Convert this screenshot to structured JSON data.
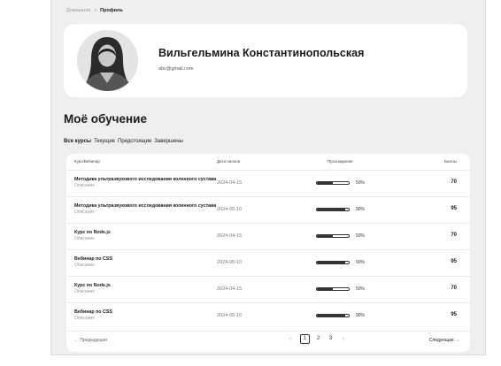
{
  "breadcrumb": {
    "home": "Домашняя",
    "separator": "»",
    "current": "Профиль"
  },
  "profile": {
    "name": "Вильгельмина Константинопольская",
    "email": "abc@gmail.com"
  },
  "section_title": "Моё обучение",
  "tabs": [
    "Все курсы",
    "Текущие",
    "Предстоящие",
    "Завершены"
  ],
  "table": {
    "headers": {
      "course": "Курс/Вебинар",
      "date": "Дата начала",
      "progress": "Прохождение",
      "score": "Баллы"
    },
    "rows": [
      {
        "title": "Методика ультразвукового исследования коленного сустава",
        "desc": "Описание",
        "date": "2024-04-15",
        "progress": 50,
        "progress_label": "50%",
        "score": "70"
      },
      {
        "title": "Методика ультразвукового исследования коленного сустава",
        "desc": "Описание",
        "date": "2024-05-10",
        "progress": 90,
        "progress_label": "90%",
        "score": "95"
      },
      {
        "title": "Курс по Node.js",
        "desc": "Описание",
        "date": "2024-04-15",
        "progress": 50,
        "progress_label": "50%",
        "score": "70"
      },
      {
        "title": "Вебинар по CSS",
        "desc": "Описание",
        "date": "2024-05-10",
        "progress": 90,
        "progress_label": "90%",
        "score": "95"
      },
      {
        "title": "Курс по Node.js",
        "desc": "Описание",
        "date": "2024-04-15",
        "progress": 50,
        "progress_label": "50%",
        "score": "70"
      },
      {
        "title": "Вебинар по CSS",
        "desc": "Описание",
        "date": "2024-05-10",
        "progress": 90,
        "progress_label": "90%",
        "score": "95"
      }
    ]
  },
  "pagination": {
    "prev": "← Предыдущая",
    "next": "Следующая →",
    "prev_chevron": "‹",
    "next_chevron": "›",
    "pages": [
      "1",
      "2",
      "3"
    ],
    "current": "1"
  },
  "colors": {
    "page_bg": "#efefef",
    "card_bg": "#ffffff",
    "accent": "#333333",
    "avatar_top": "#2a9d8f"
  },
  "icons": {
    "avatar": "user-photo-avatar",
    "prev": "arrow-left-icon",
    "next": "arrow-right-icon"
  }
}
